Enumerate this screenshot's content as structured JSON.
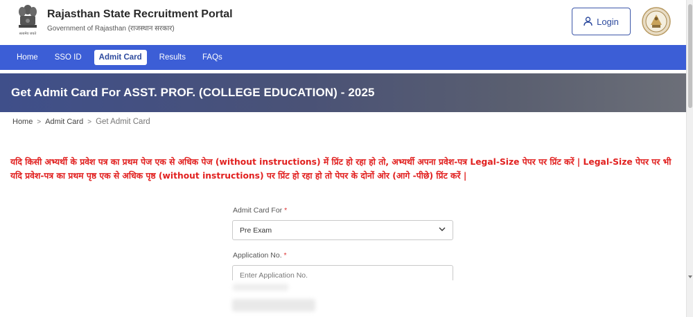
{
  "header": {
    "title": "Rajasthan State Recruitment Portal",
    "subtitle": "Government of Rajasthan (राजस्थान सरकार)",
    "login_label": "Login"
  },
  "nav": {
    "items": [
      {
        "label": "Home"
      },
      {
        "label": "SSO ID"
      },
      {
        "label": "Admit Card"
      },
      {
        "label": "Results"
      },
      {
        "label": "FAQs"
      }
    ],
    "active_label": "Admit Card"
  },
  "banner": {
    "title": "Get Admit Card For ASST. PROF. (COLLEGE EDUCATION) - 2025"
  },
  "breadcrumb": {
    "items": [
      "Home",
      "Admit Card",
      "Get Admit Card"
    ],
    "separator": ">"
  },
  "notice": {
    "text": "यदि किसी अभ्यर्थी के प्रवेश पत्र का प्रथम पेज एक से अधिक पेज (without instructions) में प्रिंट हो रहा हो तो, अभ्यर्थी अपना प्रवेश-पत्र Legal-Size पेपर पर प्रिंट करें | Legal-Size पेपर पर भी यदि प्रवेश-पत्र का प्रथम पृष्ठ एक से अधिक पृष्ठ (without instructions) पर प्रिंट हो रहा हो तो पेपर के दोनों ओर (आगे -पीछे) प्रिंट करें |"
  },
  "form": {
    "admit_card_for_label": "Admit Card For",
    "admit_card_for_value": "Pre Exam",
    "application_no_label": "Application No.",
    "application_no_placeholder": "Enter Application No.",
    "required_mark": "*"
  },
  "colors": {
    "nav_bg": "#3c5ed6",
    "notice_red": "#e1201f",
    "brand_blue": "#2d4a9e"
  },
  "icons": {
    "emblem": "ashoka-emblem-icon",
    "user": "user-icon",
    "seal": "rajasthan-seal-icon",
    "chevron": "chevron-down-icon"
  }
}
